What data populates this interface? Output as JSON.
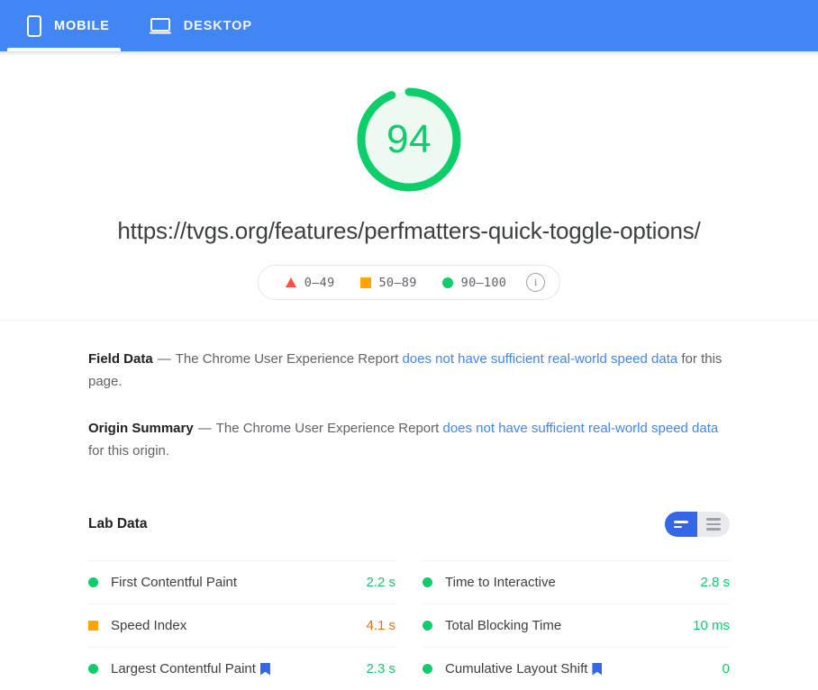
{
  "tabs": [
    {
      "id": "mobile",
      "label": "MOBILE",
      "icon": "mobile-phone-icon",
      "active": true
    },
    {
      "id": "desktop",
      "label": "DESKTOP",
      "icon": "desktop-monitor-icon",
      "active": false
    }
  ],
  "score": {
    "value": "94",
    "percent": 94,
    "color": "#0cce6b",
    "track_color": "#eef9f2"
  },
  "url": "https://tvgs.org/features/perfmatters-quick-toggle-options/",
  "legend": {
    "items": [
      {
        "shape": "triangle",
        "color": "#ff4e42",
        "range": "0–49"
      },
      {
        "shape": "square",
        "color": "#ffa400",
        "range": "50–89"
      },
      {
        "shape": "circle",
        "color": "#0cce6b",
        "range": "90–100"
      }
    ],
    "info_glyph": "i"
  },
  "field_data": {
    "title": "Field Data",
    "dash": "—",
    "text_before": "The Chrome User Experience Report",
    "link": "does not have sufficient real-world speed data",
    "text_after": "for this page."
  },
  "origin_summary": {
    "title": "Origin Summary",
    "dash": "—",
    "text_before": "The Chrome User Experience Report",
    "link": "does not have sufficient real-world speed data",
    "text_after": "for this origin."
  },
  "lab_data": {
    "title": "Lab Data",
    "view_toggle": {
      "compact_label": "compact-view",
      "expanded_label": "expanded-view",
      "active": "compact-view",
      "active_color": "#3367e8"
    },
    "left_column": [
      {
        "status": "green",
        "name": "First Contentful Paint",
        "flag": false,
        "value": "2.2 s",
        "value_color": "green"
      },
      {
        "status": "orange",
        "name": "Speed Index",
        "flag": false,
        "value": "4.1 s",
        "value_color": "orange"
      },
      {
        "status": "green",
        "name": "Largest Contentful Paint",
        "flag": true,
        "value": "2.3 s",
        "value_color": "green"
      }
    ],
    "right_column": [
      {
        "status": "green",
        "name": "Time to Interactive",
        "flag": false,
        "value": "2.8 s",
        "value_color": "green"
      },
      {
        "status": "green",
        "name": "Total Blocking Time",
        "flag": false,
        "value": "10 ms",
        "value_color": "green"
      },
      {
        "status": "green",
        "name": "Cumulative Layout Shift",
        "flag": true,
        "value": "0",
        "value_color": "green"
      }
    ]
  }
}
